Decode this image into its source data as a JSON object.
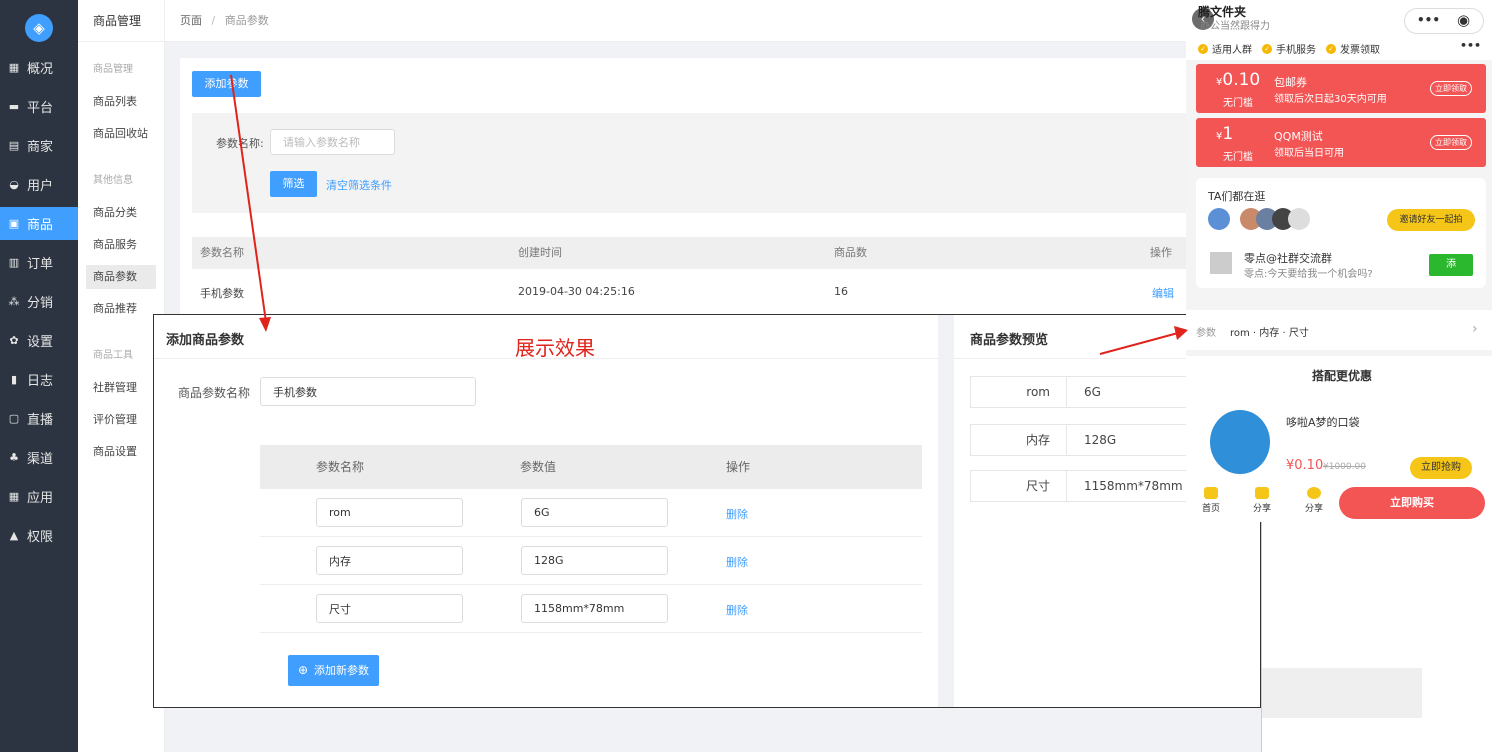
{
  "sidebar": {
    "items": [
      {
        "label": "概况",
        "icon": "chart-icon"
      },
      {
        "label": "平台",
        "icon": "monitor-icon"
      },
      {
        "label": "商家",
        "icon": "shop-icon"
      },
      {
        "label": "用户",
        "icon": "user-icon"
      },
      {
        "label": "商品",
        "icon": "goods-icon"
      },
      {
        "label": "订单",
        "icon": "order-icon"
      },
      {
        "label": "分销",
        "icon": "share-icon"
      },
      {
        "label": "设置",
        "icon": "gear-icon"
      },
      {
        "label": "日志",
        "icon": "log-icon"
      },
      {
        "label": "直播",
        "icon": "live-icon"
      },
      {
        "label": "渠道",
        "icon": "channel-icon"
      },
      {
        "label": "应用",
        "icon": "grid-icon"
      },
      {
        "label": "权限",
        "icon": "lock-icon"
      }
    ]
  },
  "submenu": {
    "title": "商品管理",
    "groups": [
      "商品管理",
      "其他信息",
      "商品工具"
    ],
    "items": [
      "商品列表",
      "商品回收站",
      "商品分类",
      "商品服务",
      "商品参数",
      "商品推荐",
      "社群管理",
      "评价管理",
      "商品设置"
    ]
  },
  "breadcrumb": {
    "home": "页面",
    "sep": "/",
    "current": "商品参数"
  },
  "toolbar": {
    "add_label": "添加参数"
  },
  "filter": {
    "label": "参数名称:",
    "placeholder": "请输入参数名称",
    "filter_btn": "筛选",
    "clear_link": "清空筛选条件"
  },
  "table": {
    "headers": [
      "参数名称",
      "创建时间",
      "商品数",
      "操作"
    ],
    "rows": [
      {
        "name": "手机参数",
        "created": "2019-04-30 04:25:16",
        "count": "16",
        "action": "编辑"
      }
    ]
  },
  "panel": {
    "title": "添加商品参数",
    "name_label": "商品参数名称",
    "name_value": "手机参数",
    "headers": [
      "参数名称",
      "参数值",
      "操作"
    ],
    "rows": [
      {
        "name": "rom",
        "value": "6G",
        "action": "删除"
      },
      {
        "name": "内存",
        "value": "128G",
        "action": "删除"
      },
      {
        "name": "尺寸",
        "value": "1158mm*78mm",
        "action": "删除"
      }
    ],
    "add_label": "添加新参数",
    "preview_title": "商品参数预览"
  },
  "annotation": "展示效果",
  "phone": {
    "title": "腾文件夹",
    "subtitle": "办公当然跟得力",
    "tags": [
      "适用人群",
      "手机服务",
      "发票领取"
    ],
    "coupons": [
      {
        "amount": "0.10",
        "currency": "¥",
        "cond": "无门槛",
        "title": "包邮券",
        "desc": "领取后次日起30天内可用",
        "get": "立即领取"
      },
      {
        "amount": "1",
        "currency": "¥",
        "cond": "无门槛",
        "title": "QQM测试",
        "desc": "领取后当日可用",
        "get": "立即领取"
      }
    ],
    "group": {
      "title": "TA们都在逛",
      "invite": "邀请好友一起拍",
      "community": "零点@社群交流群",
      "community_desc": "零点:今天要给我一个机会吗?",
      "join": "添"
    },
    "param_label": "参数",
    "param_value": "rom · 内存 · 尺寸",
    "combo_title": "搭配更优惠",
    "product": {
      "name": "哆啦A梦的口袋",
      "price": "¥0.10",
      "original": "¥1000.00",
      "buy": "立即抢购"
    },
    "tabbar": [
      "首页",
      "分享",
      "分享"
    ],
    "buy_now": "立即购买"
  }
}
